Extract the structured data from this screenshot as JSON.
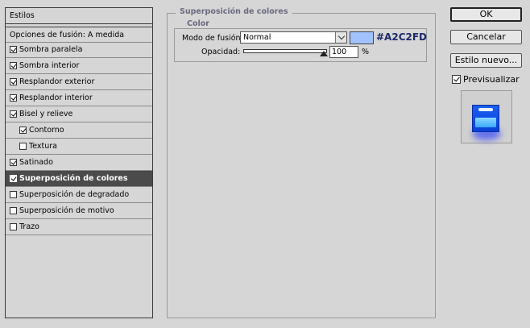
{
  "styles_panel": {
    "header": "Estilos",
    "blend_options": "Opciones de fusión: A medida",
    "items": [
      {
        "label": "Sombra paralela",
        "checked": true
      },
      {
        "label": "Sombra interior",
        "checked": true
      },
      {
        "label": "Resplandor exterior",
        "checked": true
      },
      {
        "label": "Resplandor interior",
        "checked": true
      },
      {
        "label": "Bisel y relieve",
        "checked": true
      },
      {
        "label": "Contorno",
        "checked": true
      },
      {
        "label": "Textura",
        "checked": false
      },
      {
        "label": "Satinado",
        "checked": true
      },
      {
        "label": "Superposición de colores",
        "checked": true,
        "selected": true
      },
      {
        "label": "Superposición de degradado",
        "checked": false
      },
      {
        "label": "Superposición de motivo",
        "checked": false
      },
      {
        "label": "Trazo",
        "checked": false
      }
    ]
  },
  "color_overlay": {
    "group_title": "Superposición de colores",
    "subgroup_title": "Color",
    "blend_mode_label": "Modo de fusión:",
    "blend_mode_value": "Normal",
    "swatch_color": "#A2C2FD",
    "hex_text": "#A2C2FD",
    "opacity_label": "Opacidad:",
    "opacity_value": "100",
    "opacity_percent": 100,
    "opacity_unit": "%"
  },
  "buttons": {
    "ok": "OK",
    "cancel": "Cancelar",
    "new_style": "Estilo nuevo...",
    "preview_label": "Previsualizar",
    "preview_checked": true
  },
  "colors": {
    "selected_row_bg": "#4b4b4b",
    "preview_blue": "#1a5ef0"
  }
}
